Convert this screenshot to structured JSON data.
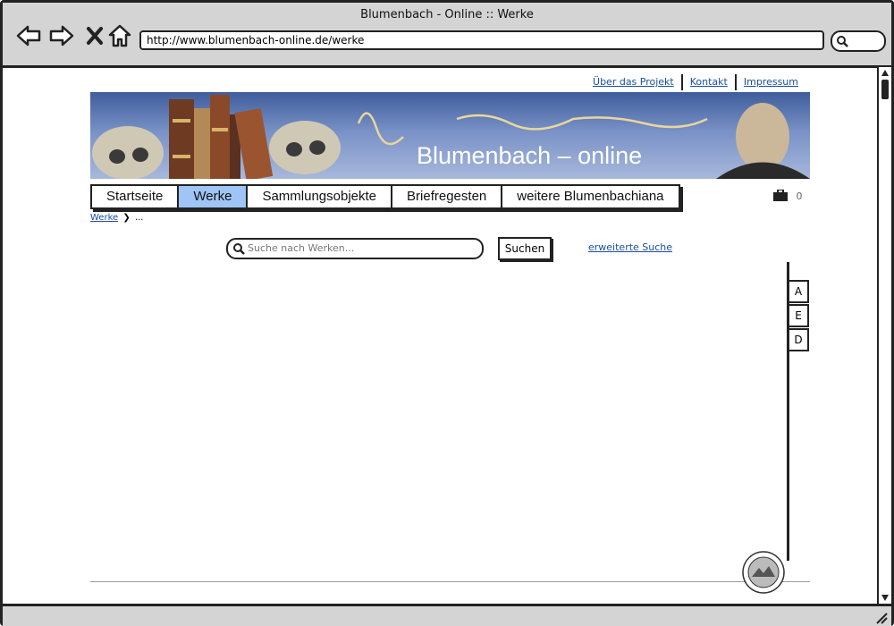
{
  "browser": {
    "title": "Blumenbach - Online :: Werke",
    "url": "http://www.blumenbach-online.de/werke",
    "icons": [
      "back-arrow-icon",
      "forward-arrow-icon",
      "close-icon",
      "home-icon",
      "search-icon"
    ]
  },
  "toplinks": [
    "Über das Projekt",
    "Kontakt",
    "Impressum"
  ],
  "banner": {
    "title": "Blumenbach – online"
  },
  "menu": {
    "items": [
      "Startseite",
      "Werke",
      "Sammlungsobjekte",
      "Briefregesten",
      "weitere Blumenbachiana"
    ],
    "active_index": 1,
    "active_color": "#9ec5f5"
  },
  "cart": {
    "count": "0"
  },
  "breadcrumb": {
    "link": "Werke",
    "rest": "..."
  },
  "search": {
    "placeholder": "Suche nach Werken...",
    "button": "Suchen",
    "advanced": "erweiterte Suche"
  },
  "side_tabs": [
    "A",
    "E",
    "D"
  ]
}
